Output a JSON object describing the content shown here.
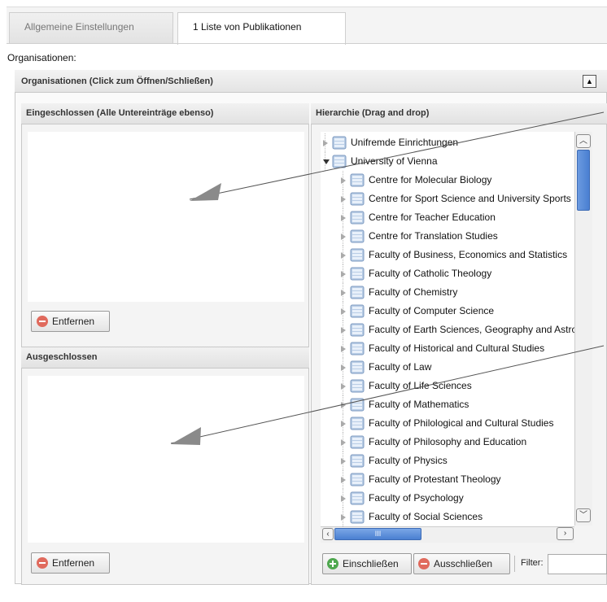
{
  "tabs": [
    {
      "label": "Allgemeine Einstellungen"
    },
    {
      "label": "1 Liste von Publikationen"
    }
  ],
  "organisations_label": "Organisationen:",
  "section": {
    "title": "Organisationen (Click zum Öffnen/Schließen)",
    "collapse_icon": "▲"
  },
  "included": {
    "title": "Eingeschlossen (Alle Untereinträge ebenso)",
    "remove_label": "Entfernen"
  },
  "excluded": {
    "title": "Ausgeschlossen",
    "remove_label": "Entfernen"
  },
  "hierarchy": {
    "title": "Hierarchie (Drag and drop)",
    "items": [
      {
        "label": "Unifremde Einrichtungen",
        "level": 0,
        "state": "collapsed"
      },
      {
        "label": "University of Vienna",
        "level": 0,
        "state": "expanded"
      },
      {
        "label": "Centre for Molecular Biology",
        "level": 1,
        "state": "collapsed"
      },
      {
        "label": "Centre for Sport Science and University Sports",
        "level": 1,
        "state": "collapsed"
      },
      {
        "label": "Centre for Teacher Education",
        "level": 1,
        "state": "collapsed"
      },
      {
        "label": "Centre for Translation Studies",
        "level": 1,
        "state": "collapsed"
      },
      {
        "label": "Faculty of Business, Economics and Statistics",
        "level": 1,
        "state": "collapsed"
      },
      {
        "label": "Faculty of Catholic Theology",
        "level": 1,
        "state": "collapsed"
      },
      {
        "label": "Faculty of Chemistry",
        "level": 1,
        "state": "collapsed"
      },
      {
        "label": "Faculty of Computer Science",
        "level": 1,
        "state": "collapsed"
      },
      {
        "label": "Faculty of Earth Sciences, Geography and Astronomy",
        "level": 1,
        "state": "collapsed"
      },
      {
        "label": "Faculty of Historical and Cultural Studies",
        "level": 1,
        "state": "collapsed"
      },
      {
        "label": "Faculty of Law",
        "level": 1,
        "state": "collapsed"
      },
      {
        "label": "Faculty of Life Sciences",
        "level": 1,
        "state": "collapsed"
      },
      {
        "label": "Faculty of Mathematics",
        "level": 1,
        "state": "collapsed"
      },
      {
        "label": "Faculty of Philological and Cultural Studies",
        "level": 1,
        "state": "collapsed"
      },
      {
        "label": "Faculty of Philosophy and Education",
        "level": 1,
        "state": "collapsed"
      },
      {
        "label": "Faculty of Physics",
        "level": 1,
        "state": "collapsed"
      },
      {
        "label": "Faculty of Protestant Theology",
        "level": 1,
        "state": "collapsed"
      },
      {
        "label": "Faculty of Psychology",
        "level": 1,
        "state": "collapsed"
      },
      {
        "label": "Faculty of Social Sciences",
        "level": 1,
        "state": "collapsed"
      }
    ],
    "hscroll_grip": "III",
    "include_label": "Einschließen",
    "exclude_label": "Ausschließen",
    "filter_label": "Filter:",
    "filter_value": ""
  },
  "colors": {
    "accent_blue": "#4a7fd1",
    "remove_red": "#e06a5d",
    "add_green": "#4fa84f",
    "annotation_arrow": "#8a8a8a"
  }
}
